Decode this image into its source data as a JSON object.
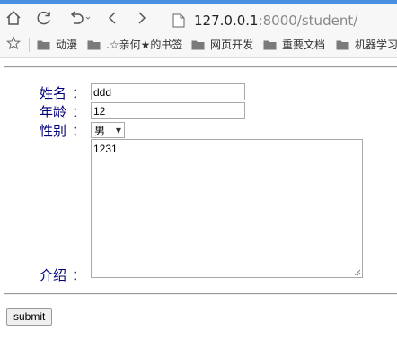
{
  "browser": {
    "url_host": "127.0.0.1",
    "url_rest": ":8000/student/",
    "bookmarks": [
      "动漫",
      ".☆亲何★的书签",
      "网页开发",
      "重要文档",
      "机器学习"
    ]
  },
  "form": {
    "name_label": "姓名",
    "age_label": "年龄",
    "gender_label": "性别",
    "intro_label": "介绍",
    "colon": "：",
    "name_value": "ddd",
    "age_value": "12",
    "gender_value": "男",
    "intro_value": "1231",
    "submit_label": "submit"
  }
}
